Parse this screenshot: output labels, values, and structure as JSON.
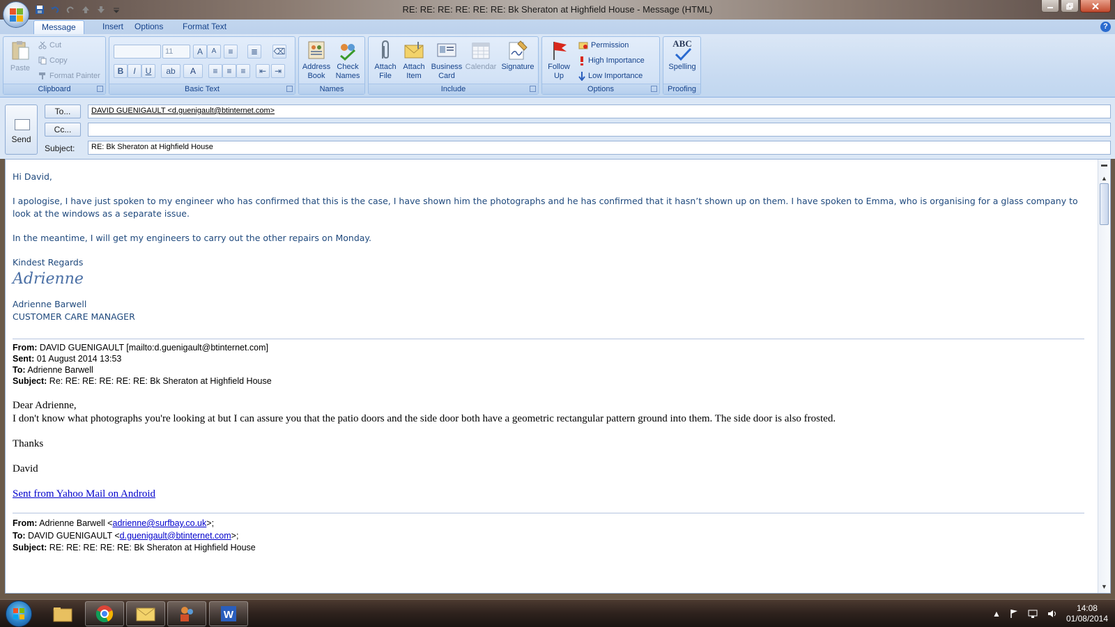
{
  "window": {
    "title": "RE: RE: RE: RE: RE: RE: Bk Sheraton at Highfield House  - Message (HTML)"
  },
  "tabs": [
    {
      "label": "Message",
      "active": true
    },
    {
      "label": "Insert"
    },
    {
      "label": "Options"
    },
    {
      "label": "Format Text"
    }
  ],
  "ribbon": {
    "clipboard": {
      "label": "Clipboard",
      "paste": "Paste",
      "cut": "Cut",
      "copy": "Copy",
      "format_painter": "Format Painter"
    },
    "basic_text": {
      "label": "Basic Text",
      "font_size": "11",
      "bold": "B",
      "italic": "I",
      "underline": "U"
    },
    "names": {
      "label": "Names",
      "address_book_1": "Address",
      "address_book_2": "Book",
      "check_names_1": "Check",
      "check_names_2": "Names"
    },
    "include": {
      "label": "Include",
      "attach_file_1": "Attach",
      "attach_file_2": "File",
      "attach_item_1": "Attach",
      "attach_item_2": "Item",
      "business_card_1": "Business",
      "business_card_2": "Card",
      "calendar": "Calendar",
      "signature": "Signature"
    },
    "options": {
      "label": "Options",
      "follow_up_1": "Follow",
      "follow_up_2": "Up",
      "permission": "Permission",
      "high_importance": "High Importance",
      "low_importance": "Low Importance"
    },
    "proofing": {
      "label": "Proofing",
      "spelling": "Spelling",
      "abc": "ABC"
    }
  },
  "header": {
    "send": "Send",
    "to_button": "To...",
    "cc_button": "Cc...",
    "subject_label": "Subject:",
    "to_value": "DAVID GUENIGAULT <d.guenigault@btinternet.com>",
    "cc_value": "",
    "subject_value": "RE: Bk Sheraton at Highfield House"
  },
  "body": {
    "greeting": "Hi David,",
    "para1": "I apologise, I have just spoken to my engineer who has confirmed that this is the case, I have shown him the photographs and he has confirmed that it hasn’t shown up on them.  I have spoken to Emma, who is organising for a glass company to look at the windows as a separate issue.",
    "para2": "In the meantime, I will get my engineers to carry out the other repairs on Monday.",
    "closing": "Kindest Regards",
    "signature": "Adrienne",
    "sender_name": "Adrienne Barwell",
    "sender_title": "CUSTOMER CARE MANAGER",
    "quote1": {
      "from_label": "From:",
      "from": "DAVID GUENIGAULT [mailto:d.guenigault@btinternet.com]",
      "sent_label": "Sent:",
      "sent": "01 August 2014 13:53",
      "to_label": "To:",
      "to": "Adrienne Barwell",
      "subject_label": "Subject:",
      "subject": "Re: RE: RE: RE: RE: RE: Bk Sheraton at Highfield House",
      "salutation": "Dear Adrienne,",
      "text": "I don't know what photographs you're looking at but I can assure you that the patio doors and the side door both have a geometric rectangular pattern ground into them. The side door is also frosted.",
      "thanks": "Thanks",
      "name": "David",
      "link": "Sent from Yahoo Mail on Android"
    },
    "quote2": {
      "from_label": "From:",
      "from_name": "Adrienne Barwell <",
      "from_email": "adrienne@surfbay.co.uk",
      "from_end": ">;",
      "to_label": "To:",
      "to_name": "DAVID GUENIGAULT <",
      "to_email": "d.guenigault@btinternet.com",
      "to_end": ">;",
      "subject_label": "Subject:",
      "subject": "RE: RE: RE: RE: RE: Bk Sheraton at Highfield House"
    }
  },
  "taskbar": {
    "time": "14:08",
    "date": "01/08/2014"
  }
}
